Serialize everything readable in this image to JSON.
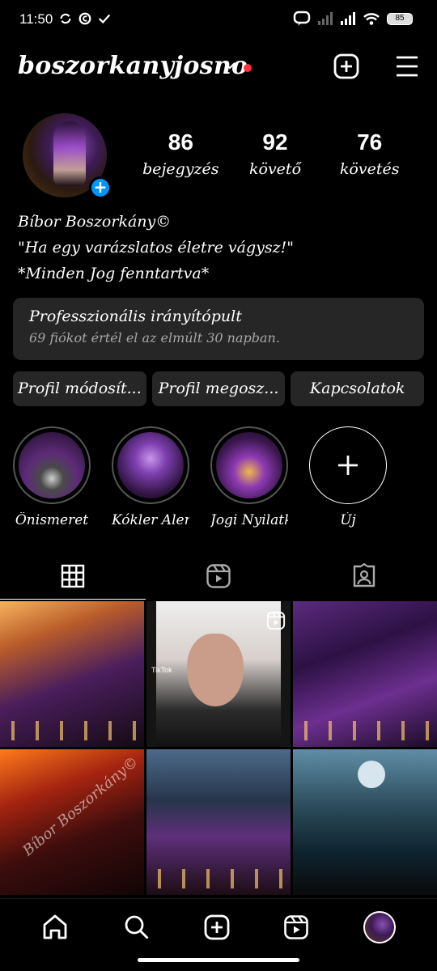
{
  "status_bar": {
    "time": "11:50",
    "battery": "85",
    "icons": [
      "sync-icon",
      "c-circle-icon",
      "check-icon",
      "chat-icon",
      "signal-icon",
      "signal-icon",
      "wifi-icon"
    ]
  },
  "header": {
    "username": "boszorkanyjosno",
    "has_notification_dot": true,
    "icons": [
      "chevron-down-icon",
      "add-post-icon",
      "menu-icon"
    ]
  },
  "profile": {
    "stats": [
      {
        "value": "86",
        "label": "bejegyzés"
      },
      {
        "value": "92",
        "label": "követő"
      },
      {
        "value": "76",
        "label": "követés"
      }
    ],
    "bio": {
      "name": "Bíbor Boszorkány©",
      "line1": "\"Ha egy varázslatos életre vágysz!\"",
      "line2": "*Minden Jog fenntartva*"
    }
  },
  "dashboard": {
    "title": "Professzionális irányítópult",
    "subtitle": "69 fiókot értél el az elmúlt 30 napban."
  },
  "buttons": [
    "Profil módosít...",
    "Profil megosz...",
    "Kapcsolatok"
  ],
  "highlights": [
    {
      "label": "Önismeret"
    },
    {
      "label": "Kókler Alert"
    },
    {
      "label": "Jogi Nyilatk..."
    },
    {
      "label": "Új"
    }
  ],
  "tabs": [
    "grid-icon",
    "reels-icon",
    "tagged-icon"
  ],
  "posts": {
    "tiktok_text": "TikTok",
    "watermark": "Bíbor Boszorkány©"
  },
  "bottom_nav": [
    "home-icon",
    "search-icon",
    "create-icon",
    "reels-icon",
    "profile-avatar"
  ],
  "colors": {
    "background": "#000000",
    "surface": "#262626",
    "accent_blue": "#0095f6",
    "notification_red": "#ff3040"
  }
}
